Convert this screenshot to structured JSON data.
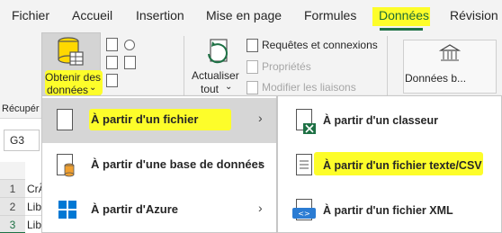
{
  "tabs": [
    "Fichier",
    "Accueil",
    "Insertion",
    "Mise en page",
    "Formules",
    "Données",
    "Révision"
  ],
  "active_tab": "Données",
  "ribbon": {
    "get_data": {
      "line1": "Obtenir des",
      "line2": "données"
    },
    "refresh": {
      "line1": "Actualiser",
      "line2": "tout"
    },
    "queries": "Requêtes et connexions",
    "properties": "Propriétés",
    "edit_links": "Modifier les liaisons",
    "data_types": "Données b...",
    "group_label": "Récupér"
  },
  "namebox": "G3",
  "grid": {
    "rows": [
      {
        "num": "1",
        "text": "CrÃ"
      },
      {
        "num": "2",
        "text": "Lib"
      },
      {
        "num": "3",
        "text": "Lib"
      }
    ]
  },
  "menu": {
    "items": [
      {
        "label": "À partir d'un fichier",
        "arrow": "›",
        "icon": "file-icon"
      },
      {
        "label": "À partir d'une base de données",
        "arrow": "›",
        "icon": "database-icon"
      },
      {
        "label": "À partir d'Azure",
        "arrow": "›",
        "icon": "azure-windows-icon"
      }
    ]
  },
  "submenu": {
    "items": [
      {
        "label": "À partir d'un classeur",
        "icon": "excel-workbook-icon"
      },
      {
        "label": "À partir d'un fichier texte/CSV",
        "icon": "text-csv-file-icon"
      },
      {
        "label": "À partir d'un fichier XML",
        "icon": "xml-file-icon"
      }
    ]
  },
  "colors": {
    "accent_green": "#1e7145",
    "highlight_yellow": "#fdfd2a",
    "ribbon_bg": "#f3f3f3",
    "hover_gray": "#d6d6d6"
  }
}
